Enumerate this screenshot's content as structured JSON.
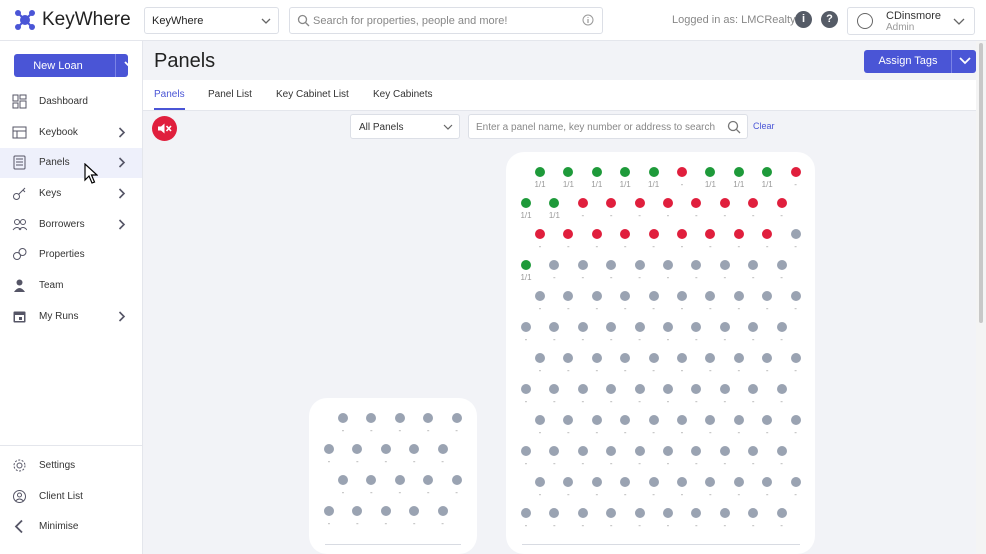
{
  "app": {
    "name": "KeyWhere"
  },
  "header": {
    "org_select": "KeyWhere",
    "search_placeholder": "Search for properties, people and more!",
    "logged_in": "Logged in as: LMCRealty",
    "user_name": "CDinsmore",
    "user_role": "Admin"
  },
  "sidebar": {
    "new_loan": "New Loan",
    "items": [
      {
        "label": "Dashboard",
        "icon": "dashboard-icon",
        "has_arrow": false
      },
      {
        "label": "Keybook",
        "icon": "keybook-icon",
        "has_arrow": true
      },
      {
        "label": "Panels",
        "icon": "panels-icon",
        "has_arrow": true,
        "active": true
      },
      {
        "label": "Keys",
        "icon": "key-icon",
        "has_arrow": true
      },
      {
        "label": "Borrowers",
        "icon": "borrowers-icon",
        "has_arrow": true
      },
      {
        "label": "Properties",
        "icon": "properties-icon",
        "has_arrow": false
      },
      {
        "label": "Team",
        "icon": "team-icon",
        "has_arrow": false
      },
      {
        "label": "My Runs",
        "icon": "calendar-icon",
        "has_arrow": true
      }
    ],
    "bottom_items": [
      {
        "label": "Settings",
        "icon": "gear-icon"
      },
      {
        "label": "Client List",
        "icon": "client-list-icon"
      },
      {
        "label": "Minimise",
        "icon": "chevron-left-icon"
      }
    ]
  },
  "page": {
    "title": "Panels",
    "assign_tags": "Assign Tags",
    "tabs": [
      "Panels",
      "Panel List",
      "Key Cabinet List",
      "Key Cabinets"
    ],
    "active_tab": "Panels",
    "filter_value": "All Panels",
    "panel_search_placeholder": "Enter a panel name, key number or address to search",
    "clear": "Clear"
  },
  "colors": {
    "accent": "#4a55d6",
    "green": "#1e9a3a",
    "red": "#e01f3d",
    "grey": "#9aa3b2"
  },
  "panels": [
    {
      "name": "large-panel",
      "rows": [
        {
          "offset": true,
          "slots": [
            "G",
            "G",
            "G",
            "G",
            "G",
            "R",
            "G",
            "G",
            "G",
            "R"
          ],
          "labels": [
            "1/1",
            "1/1",
            "1/1",
            "1/1",
            "1/1",
            "-",
            "1/1",
            "1/1",
            "1/1",
            "-"
          ]
        },
        {
          "offset": false,
          "slots": [
            "G",
            "G",
            "R",
            "R",
            "R",
            "R",
            "R",
            "R",
            "R",
            "R"
          ],
          "labels": [
            "1/1",
            "1/1",
            "-",
            "-",
            "-",
            "-",
            "-",
            "-",
            "-",
            "-"
          ]
        },
        {
          "offset": true,
          "slots": [
            "R",
            "R",
            "R",
            "R",
            "R",
            "R",
            "R",
            "R",
            "R",
            "E"
          ],
          "labels": [
            "-",
            "-",
            "-",
            "-",
            "-",
            "-",
            "-",
            "-",
            "-",
            "-"
          ]
        },
        {
          "offset": false,
          "slots": [
            "G",
            "E",
            "E",
            "E",
            "E",
            "E",
            "E",
            "E",
            "E",
            "E"
          ],
          "labels": [
            "1/1",
            "-",
            "-",
            "-",
            "-",
            "-",
            "-",
            "-",
            "-",
            "-"
          ]
        },
        {
          "offset": true,
          "slots": [
            "E",
            "E",
            "E",
            "E",
            "E",
            "E",
            "E",
            "E",
            "E",
            "E"
          ],
          "labels": [
            "-",
            "-",
            "-",
            "-",
            "-",
            "-",
            "-",
            "-",
            "-",
            "-"
          ]
        },
        {
          "offset": false,
          "slots": [
            "E",
            "E",
            "E",
            "E",
            "E",
            "E",
            "E",
            "E",
            "E",
            "E"
          ],
          "labels": [
            "-",
            "-",
            "-",
            "-",
            "-",
            "-",
            "-",
            "-",
            "-",
            "-"
          ]
        },
        {
          "offset": true,
          "slots": [
            "E",
            "E",
            "E",
            "E",
            "E",
            "E",
            "E",
            "E",
            "E",
            "E"
          ],
          "labels": [
            "-",
            "-",
            "-",
            "-",
            "-",
            "-",
            "-",
            "-",
            "-",
            "-"
          ]
        },
        {
          "offset": false,
          "slots": [
            "E",
            "E",
            "E",
            "E",
            "E",
            "E",
            "E",
            "E",
            "E",
            "E"
          ],
          "labels": [
            "-",
            "-",
            "-",
            "-",
            "-",
            "-",
            "-",
            "-",
            "-",
            "-"
          ]
        },
        {
          "offset": true,
          "slots": [
            "E",
            "E",
            "E",
            "E",
            "E",
            "E",
            "E",
            "E",
            "E",
            "E"
          ],
          "labels": [
            "-",
            "-",
            "-",
            "-",
            "-",
            "-",
            "-",
            "-",
            "-",
            "-"
          ]
        },
        {
          "offset": false,
          "slots": [
            "E",
            "E",
            "E",
            "E",
            "E",
            "E",
            "E",
            "E",
            "E",
            "E"
          ],
          "labels": [
            "-",
            "-",
            "-",
            "-",
            "-",
            "-",
            "-",
            "-",
            "-",
            "-"
          ]
        },
        {
          "offset": true,
          "slots": [
            "E",
            "E",
            "E",
            "E",
            "E",
            "E",
            "E",
            "E",
            "E",
            "E"
          ],
          "labels": [
            "-",
            "-",
            "-",
            "-",
            "-",
            "-",
            "-",
            "-",
            "-",
            "-"
          ]
        },
        {
          "offset": false,
          "slots": [
            "E",
            "E",
            "E",
            "E",
            "E",
            "E",
            "E",
            "E",
            "E",
            "E"
          ],
          "labels": [
            "-",
            "-",
            "-",
            "-",
            "-",
            "-",
            "-",
            "-",
            "-",
            "-"
          ]
        }
      ]
    },
    {
      "name": "small-panel",
      "rows": [
        {
          "offset": true,
          "slots": [
            "E",
            "E",
            "E",
            "E",
            "E"
          ],
          "labels": [
            "-",
            "-",
            "-",
            "-",
            "-"
          ]
        },
        {
          "offset": false,
          "slots": [
            "E",
            "E",
            "E",
            "E",
            "E"
          ],
          "labels": [
            "-",
            "-",
            "-",
            "-",
            "-"
          ]
        },
        {
          "offset": true,
          "slots": [
            "E",
            "E",
            "E",
            "E",
            "E"
          ],
          "labels": [
            "-",
            "-",
            "-",
            "-",
            "-"
          ]
        },
        {
          "offset": false,
          "slots": [
            "E",
            "E",
            "E",
            "E",
            "E"
          ],
          "labels": [
            "-",
            "-",
            "-",
            "-",
            "-"
          ]
        }
      ]
    }
  ]
}
